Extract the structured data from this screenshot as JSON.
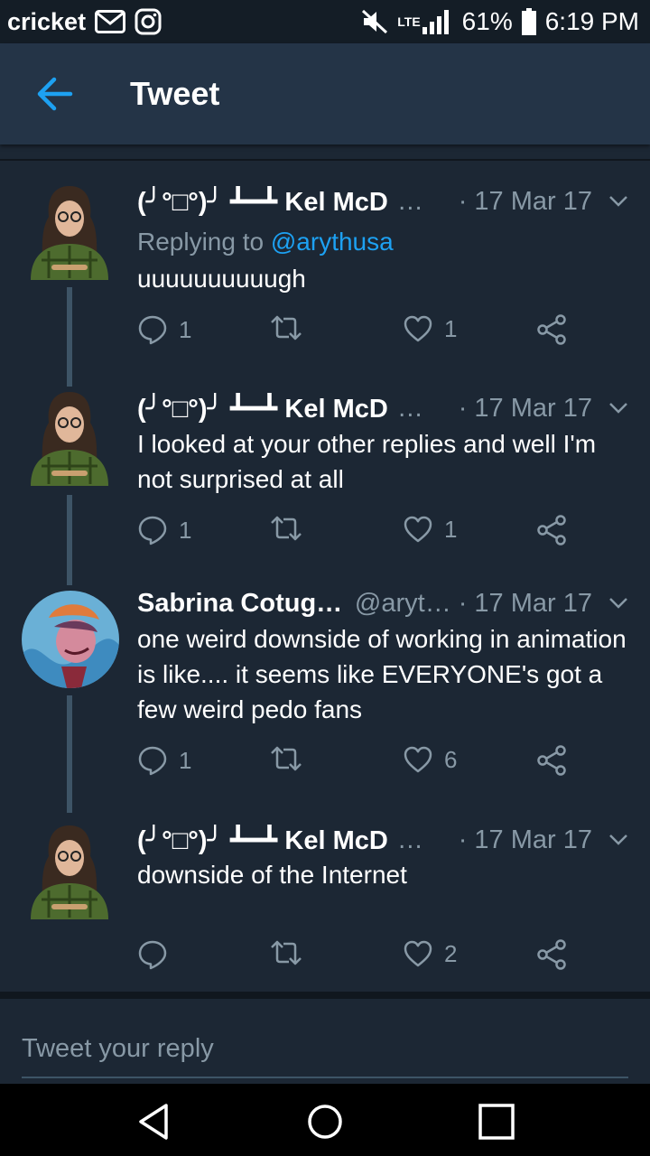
{
  "status_bar": {
    "carrier": "cricket",
    "lte": "LTE",
    "battery": "61%",
    "time": "6:19 PM",
    "icons": [
      "email-icon",
      "instagram-icon",
      "mute-icon",
      "signal-icon",
      "battery-icon"
    ]
  },
  "header": {
    "title": "Tweet",
    "back_icon": "arrow-left-icon"
  },
  "colors": {
    "background": "#1c2734",
    "header": "#243447",
    "accent": "#1da1f2",
    "muted": "#8899a6",
    "thread_line": "#3d5466"
  },
  "tweets": [
    {
      "name": "(╯°□°)╯ ┻━┻ Kel McD",
      "handle": "…",
      "date": "· 17 Mar 17",
      "replying_prefix": "Replying to ",
      "replying_to": "@arythusa",
      "text": "uuuuuuuuuugh",
      "replies": "1",
      "retweets": "",
      "likes": "1"
    },
    {
      "name": "(╯°□°)╯ ┻━┻ Kel McD",
      "handle": "…",
      "date": "· 17 Mar 17",
      "text": "I looked at your other replies and well I'm not surprised at all",
      "replies": "1",
      "retweets": "",
      "likes": "1"
    },
    {
      "name": "Sabrina Cotugno",
      "handle": "@aryt…",
      "date": "· 17 Mar 17",
      "text": "one weird downside of working in animation is like.... it seems like EVERYONE's got a few weird pedo fans",
      "replies": "1",
      "retweets": "",
      "likes": "6"
    },
    {
      "name": "(╯°□°)╯ ┻━┻ Kel McD",
      "handle": "…",
      "date": "· 17 Mar 17",
      "text": "downside of the Internet",
      "replies": "",
      "retweets": "",
      "likes": "2"
    }
  ],
  "compose": {
    "placeholder": "Tweet your reply"
  },
  "nav": {
    "back": "nav-back-icon",
    "home": "nav-home-icon",
    "recents": "nav-recents-icon"
  }
}
